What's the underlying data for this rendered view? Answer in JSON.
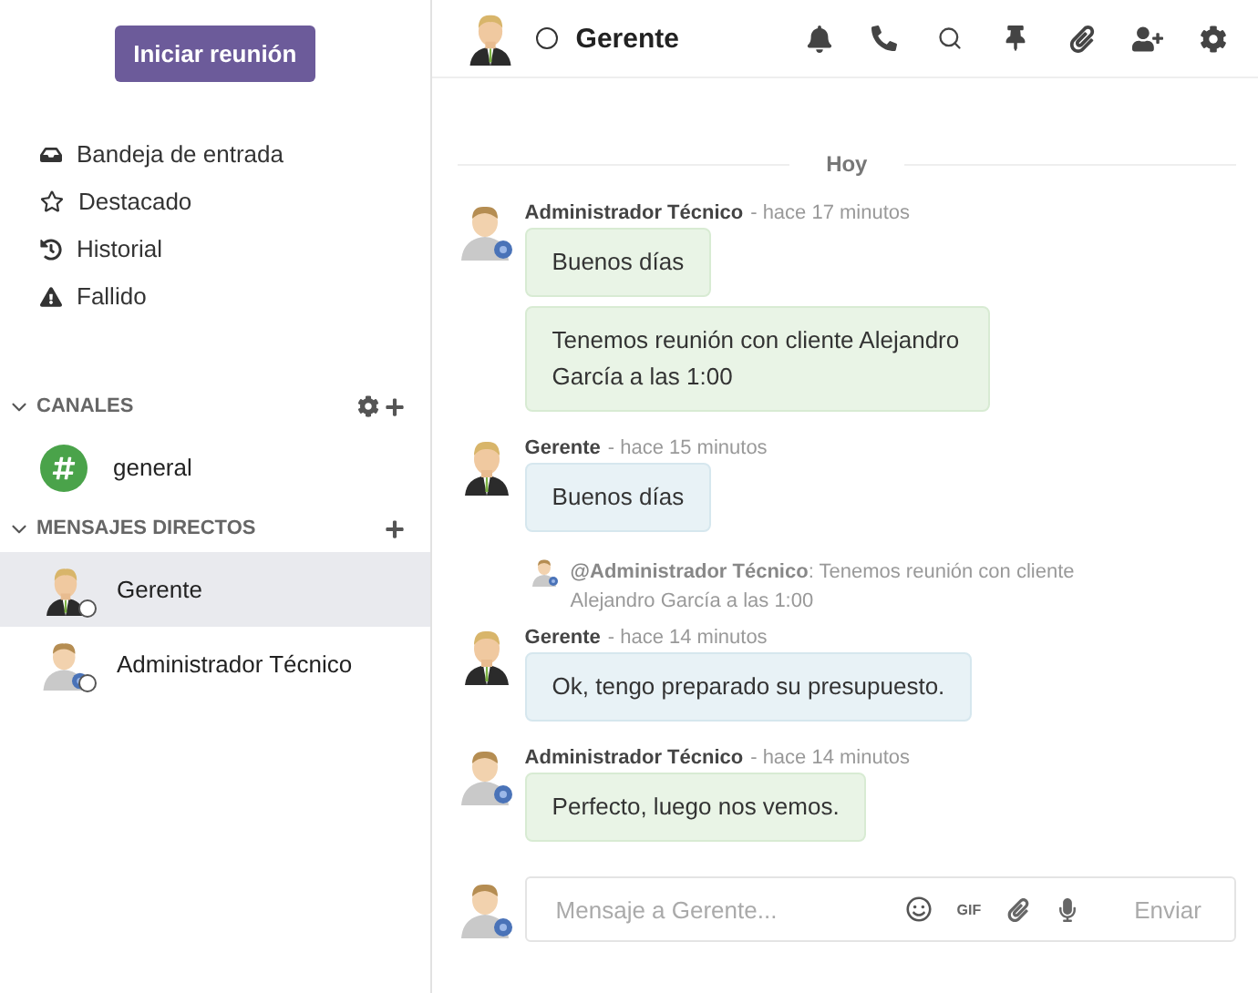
{
  "sidebar": {
    "start_button": "Iniciar reunión",
    "nav": [
      {
        "kind": "inbox",
        "label": "Bandeja de entrada"
      },
      {
        "kind": "star",
        "label": "Destacado"
      },
      {
        "kind": "history",
        "label": "Historial"
      },
      {
        "kind": "warning",
        "label": "Fallido"
      }
    ],
    "sections": [
      {
        "title": "CANALES",
        "expanded": true,
        "settings": true,
        "items": [
          {
            "kind": "channel",
            "label": "general",
            "selected": false
          }
        ]
      },
      {
        "title": "MENSAJES DIRECTOS",
        "expanded": true,
        "settings": false,
        "items": [
          {
            "kind": "manager",
            "label": "Gerente",
            "selected": true,
            "online": false
          },
          {
            "kind": "admin",
            "label": "Administrador Técnico",
            "selected": false,
            "online": false
          }
        ]
      }
    ]
  },
  "header": {
    "kind": "manager",
    "online": false,
    "title": "Gerente"
  },
  "day_separator": "Hoy",
  "messages": [
    {
      "kind": "admin",
      "own": true,
      "author": "Administrador Técnico",
      "time": "- hace 17 minutos",
      "bubbles": [
        "Buenos días",
        "Tenemos reunión con cliente Alejandro García a las 1:00"
      ]
    },
    {
      "kind": "manager",
      "own": false,
      "author": "Gerente",
      "time": "- hace 15 minutos",
      "bubbles": [
        "Buenos días"
      ]
    },
    {
      "kind": "manager",
      "own": false,
      "author": "Gerente",
      "time": "- hace 14 minutos",
      "reply": {
        "kind": "admin",
        "text": "**@Administrador Técnico**:  Tenemos reunión con cliente Alejandro García a las 1:00"
      },
      "bubbles": [
        "Ok, tengo preparado su presupuesto."
      ]
    },
    {
      "kind": "admin",
      "own": true,
      "author": "Administrador Técnico",
      "time": "- hace 14 minutos",
      "bubbles": [
        "Perfecto, luego nos vemos."
      ]
    }
  ],
  "composer": {
    "kind": "admin",
    "placeholder": "Mensaje a Gerente...",
    "gif": "GIF",
    "send": "Enviar"
  }
}
